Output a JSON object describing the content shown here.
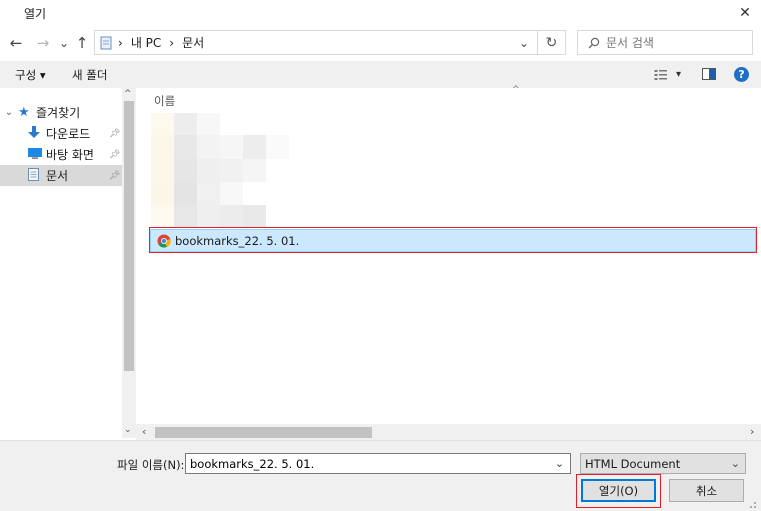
{
  "window": {
    "title": "열기",
    "close_glyph": "✕"
  },
  "nav": {
    "back_glyph": "←",
    "forward_glyph": "→",
    "recent_glyph": "⌄",
    "up_glyph": "↑",
    "breadcrumb": [
      "내 PC",
      "문서"
    ],
    "separator": "›",
    "refresh_glyph": "↻",
    "dropdown_glyph": "⌄",
    "search_placeholder": "문서 검색"
  },
  "toolbar": {
    "organize_label": "구성 ▾",
    "new_folder_label": "새 폴더",
    "view_menu_glyph": "▾",
    "help_glyph": "?"
  },
  "sidebar": {
    "items": [
      {
        "label": "즐겨찾기",
        "icon": "star-icon",
        "pinned": false,
        "expanded": true
      },
      {
        "label": "다운로드",
        "icon": "download-icon",
        "pinned": true
      },
      {
        "label": "바탕 화면",
        "icon": "desktop-icon",
        "pinned": true
      },
      {
        "label": "문서",
        "icon": "document-icon",
        "pinned": true,
        "selected": true
      }
    ]
  },
  "list": {
    "column_name": "이름",
    "sort_glyph": "^",
    "selected_file": "bookmarks_22. 5. 01."
  },
  "footer": {
    "filename_label": "파일 이름(N):",
    "filename_value": "bookmarks_22. 5. 01.",
    "filetype_value": "HTML Document",
    "open_label": "열기(O)",
    "cancel_label": "취소"
  },
  "colors": {
    "selection_bg": "#cce8ff",
    "selection_border": "#99d1ff",
    "highlight_red": "#e0202c",
    "accent_blue": "#0078d7"
  }
}
